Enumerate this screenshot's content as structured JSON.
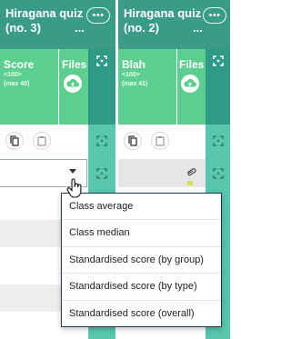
{
  "columns": [
    {
      "title_line1": "Hiragana quiz",
      "title_line2": "(no. 3)",
      "title_dots": "...",
      "more_label": "•••",
      "score_label": "Score",
      "score_sub1": "<100>",
      "score_sub2": "(max 40)",
      "files_label": "Files"
    },
    {
      "title_line1": "Hiragana quiz",
      "title_line2": "(no. 2)",
      "title_dots": "...",
      "more_label": "•••",
      "score_label": "Blah",
      "score_sub1": "<100>",
      "score_sub2": "(max 41)",
      "files_label": "Files"
    }
  ],
  "dropdown": {
    "options": [
      "Class average",
      "Class median",
      "Standardised score (by group)",
      "Standardised score (by type)",
      "Standardised score (overall)"
    ]
  },
  "colors": {
    "header_teal": "#3a9c86",
    "score_green": "#5ccf90",
    "dropdown_border": "#1f3b5a"
  },
  "icons": {
    "copy": "copy-icon",
    "paste": "clipboard-icon",
    "upload": "cloud-upload-icon",
    "expand": "expand-icon",
    "attachment": "paperclip-icon"
  }
}
